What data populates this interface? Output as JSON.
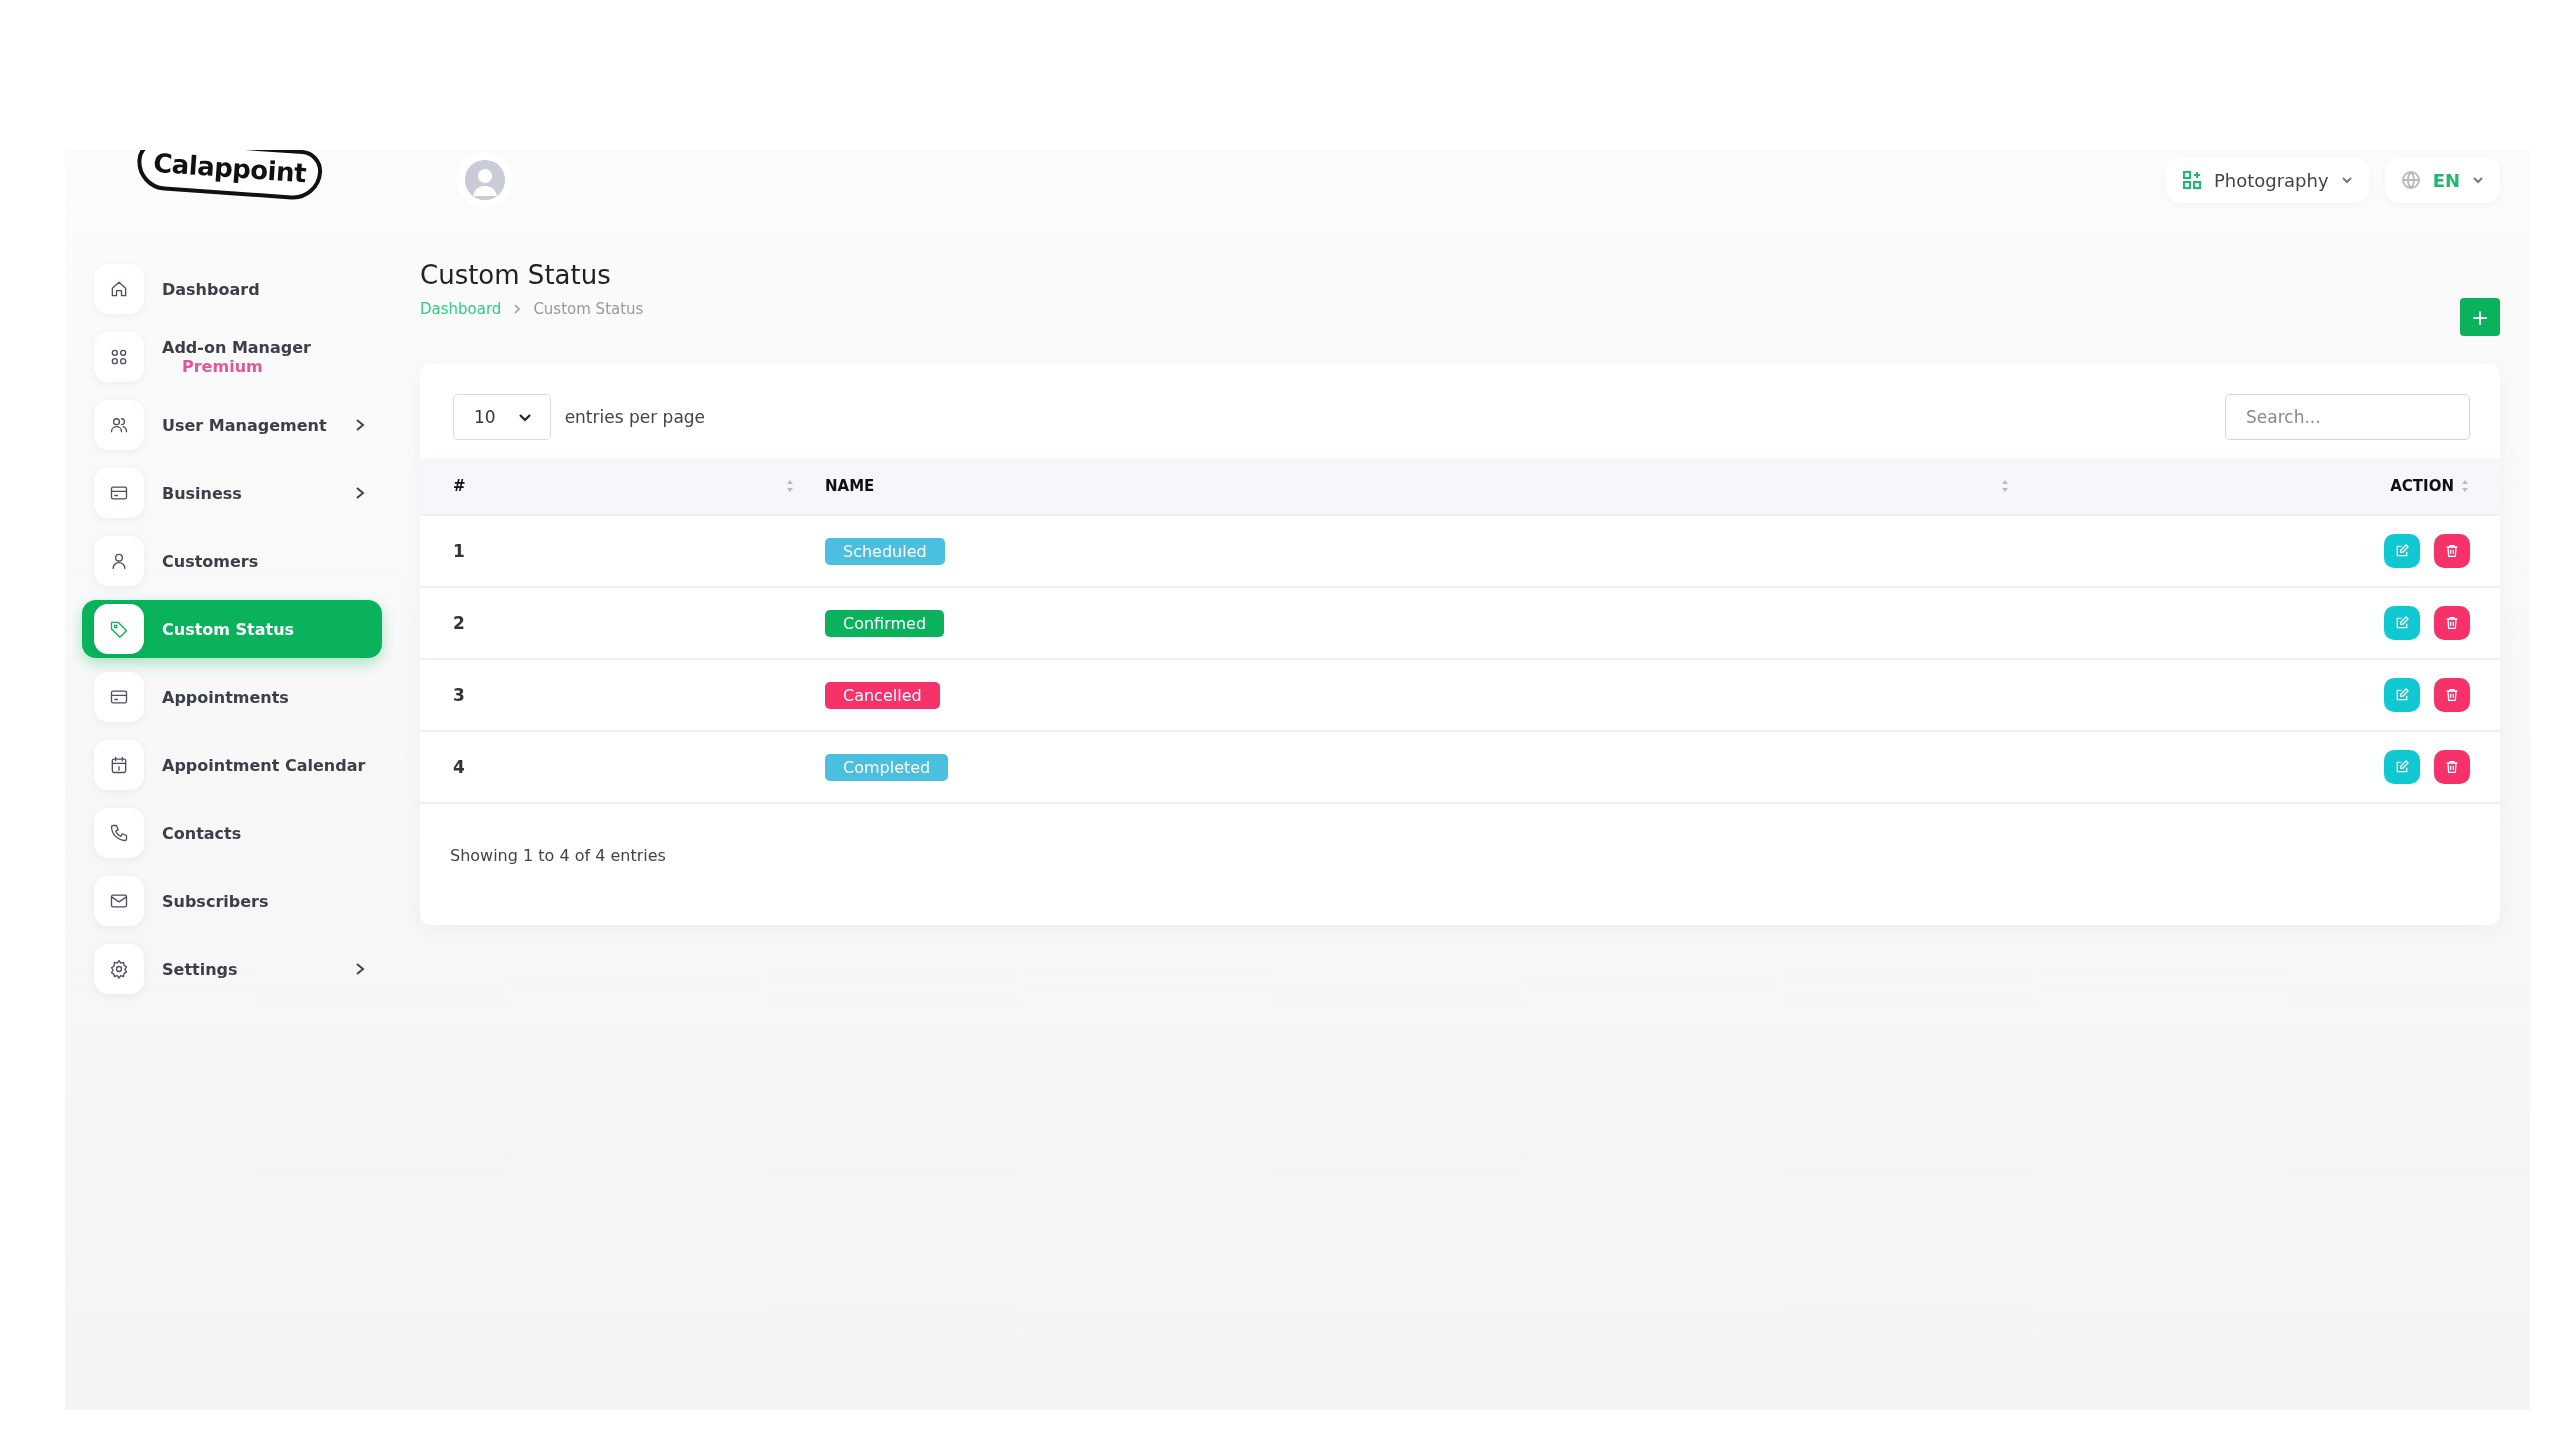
{
  "logo": {
    "text": "Calappoint"
  },
  "sidebar": {
    "items": [
      {
        "label": "Dashboard",
        "selected": false,
        "has_submenu": false
      },
      {
        "label": "Add-on Manager",
        "badge": "Premium",
        "selected": false,
        "has_submenu": false
      },
      {
        "label": "User Management",
        "selected": false,
        "has_submenu": true
      },
      {
        "label": "Business",
        "selected": false,
        "has_submenu": true
      },
      {
        "label": "Customers",
        "selected": false,
        "has_submenu": false
      },
      {
        "label": "Custom Status",
        "selected": true,
        "has_submenu": false
      },
      {
        "label": "Appointments",
        "selected": false,
        "has_submenu": false
      },
      {
        "label": "Appointment Calendar",
        "selected": false,
        "has_submenu": false
      },
      {
        "label": "Contacts",
        "selected": false,
        "has_submenu": false
      },
      {
        "label": "Subscribers",
        "selected": false,
        "has_submenu": false
      },
      {
        "label": "Settings",
        "selected": false,
        "has_submenu": true
      }
    ]
  },
  "header": {
    "business_selector": "Photography",
    "language_selector": "EN"
  },
  "page": {
    "title": "Custom Status",
    "breadcrumb": [
      {
        "label": "Dashboard",
        "link": true
      },
      {
        "label": "Custom Status",
        "link": false
      }
    ],
    "add_button": "+"
  },
  "table": {
    "page_size": "10",
    "page_size_label": "entries per page",
    "search": {
      "placeholder": "Search..."
    },
    "columns": [
      "#",
      "NAME",
      "ACTION"
    ],
    "rows": [
      {
        "number": "1",
        "status": "Scheduled",
        "color": "#4bbfe0"
      },
      {
        "number": "2",
        "status": "Confirmed",
        "color": "#0ab25b"
      },
      {
        "number": "3",
        "status": "Cancelled",
        "color": "#f5336a"
      },
      {
        "number": "4",
        "status": "Completed",
        "color": "#4bbfe0"
      }
    ],
    "footer": "Showing 1 to 4 of 4 entries"
  }
}
